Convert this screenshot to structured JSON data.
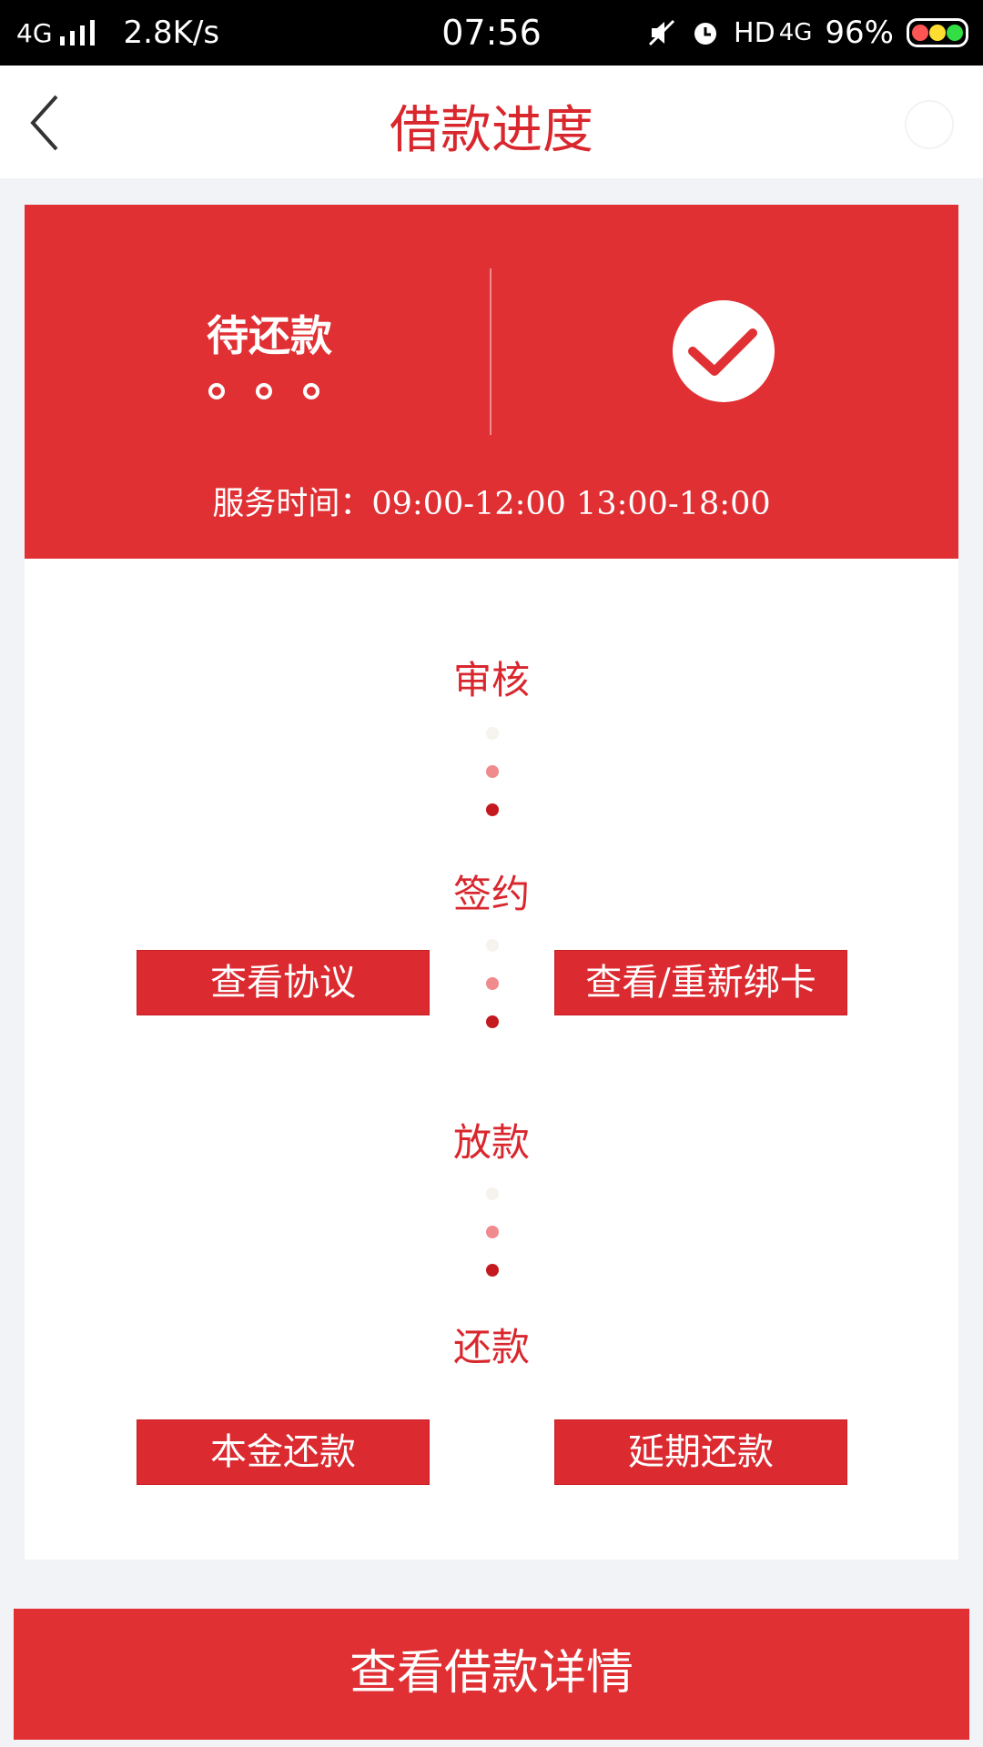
{
  "status_bar": {
    "network": "4G",
    "speed": "2.8K/s",
    "time": "07:56",
    "hd": "HD",
    "network_right": "4G",
    "battery": "96%"
  },
  "header": {
    "title": "借款进度",
    "back_icon": "chevron-left-icon"
  },
  "status_card": {
    "status": "待还款",
    "service_time": "服务时间：09:00-12:00 13:00-18:00",
    "background_color": "#e03034"
  },
  "progress": {
    "steps": [
      {
        "label": "审核"
      },
      {
        "label": "签约"
      },
      {
        "label": "放款"
      },
      {
        "label": "还款"
      }
    ],
    "sign_actions": {
      "view_agreement": "查看协议",
      "view_rebind_card": "查看/重新绑卡"
    },
    "repay_actions": {
      "principal_repay": "本金还款",
      "deferred_repay": "延期还款"
    }
  },
  "footer": {
    "main_button": "查看借款详情"
  },
  "colors": {
    "accent": "#d9272e",
    "dot_light": "#f6f2ee",
    "dot_mid": "#ef8a8d",
    "dot_dark": "#c3191f"
  }
}
